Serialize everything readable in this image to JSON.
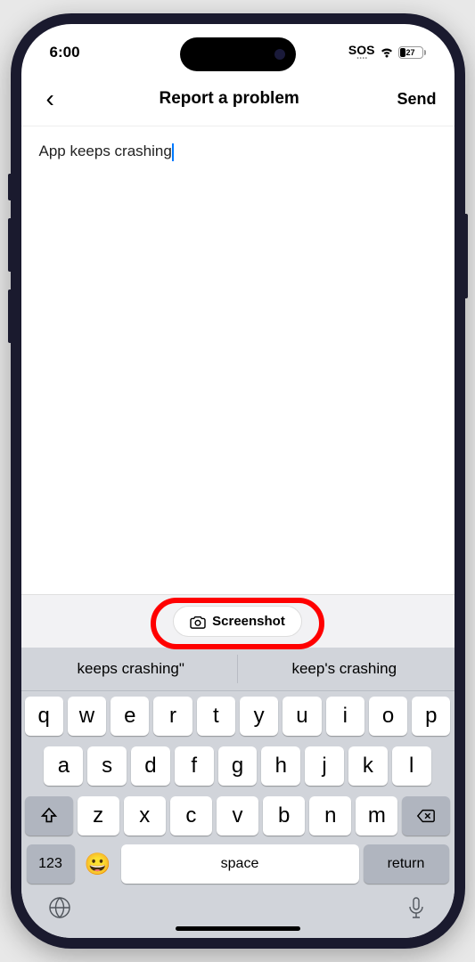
{
  "status": {
    "time": "6:00",
    "sos": "SOS",
    "battery": "27"
  },
  "nav": {
    "title": "Report a problem",
    "send": "Send"
  },
  "input": {
    "text": "App keeps crashing"
  },
  "toolbar": {
    "screenshot": "Screenshot"
  },
  "suggestions": [
    "keeps crashing\"",
    "keep's crashing"
  ],
  "keyboard": {
    "row1": [
      "q",
      "w",
      "e",
      "r",
      "t",
      "y",
      "u",
      "i",
      "o",
      "p"
    ],
    "row2": [
      "a",
      "s",
      "d",
      "f",
      "g",
      "h",
      "j",
      "k",
      "l"
    ],
    "row3": [
      "z",
      "x",
      "c",
      "v",
      "b",
      "n",
      "m"
    ],
    "numkey": "123",
    "space": "space",
    "return": "return"
  }
}
